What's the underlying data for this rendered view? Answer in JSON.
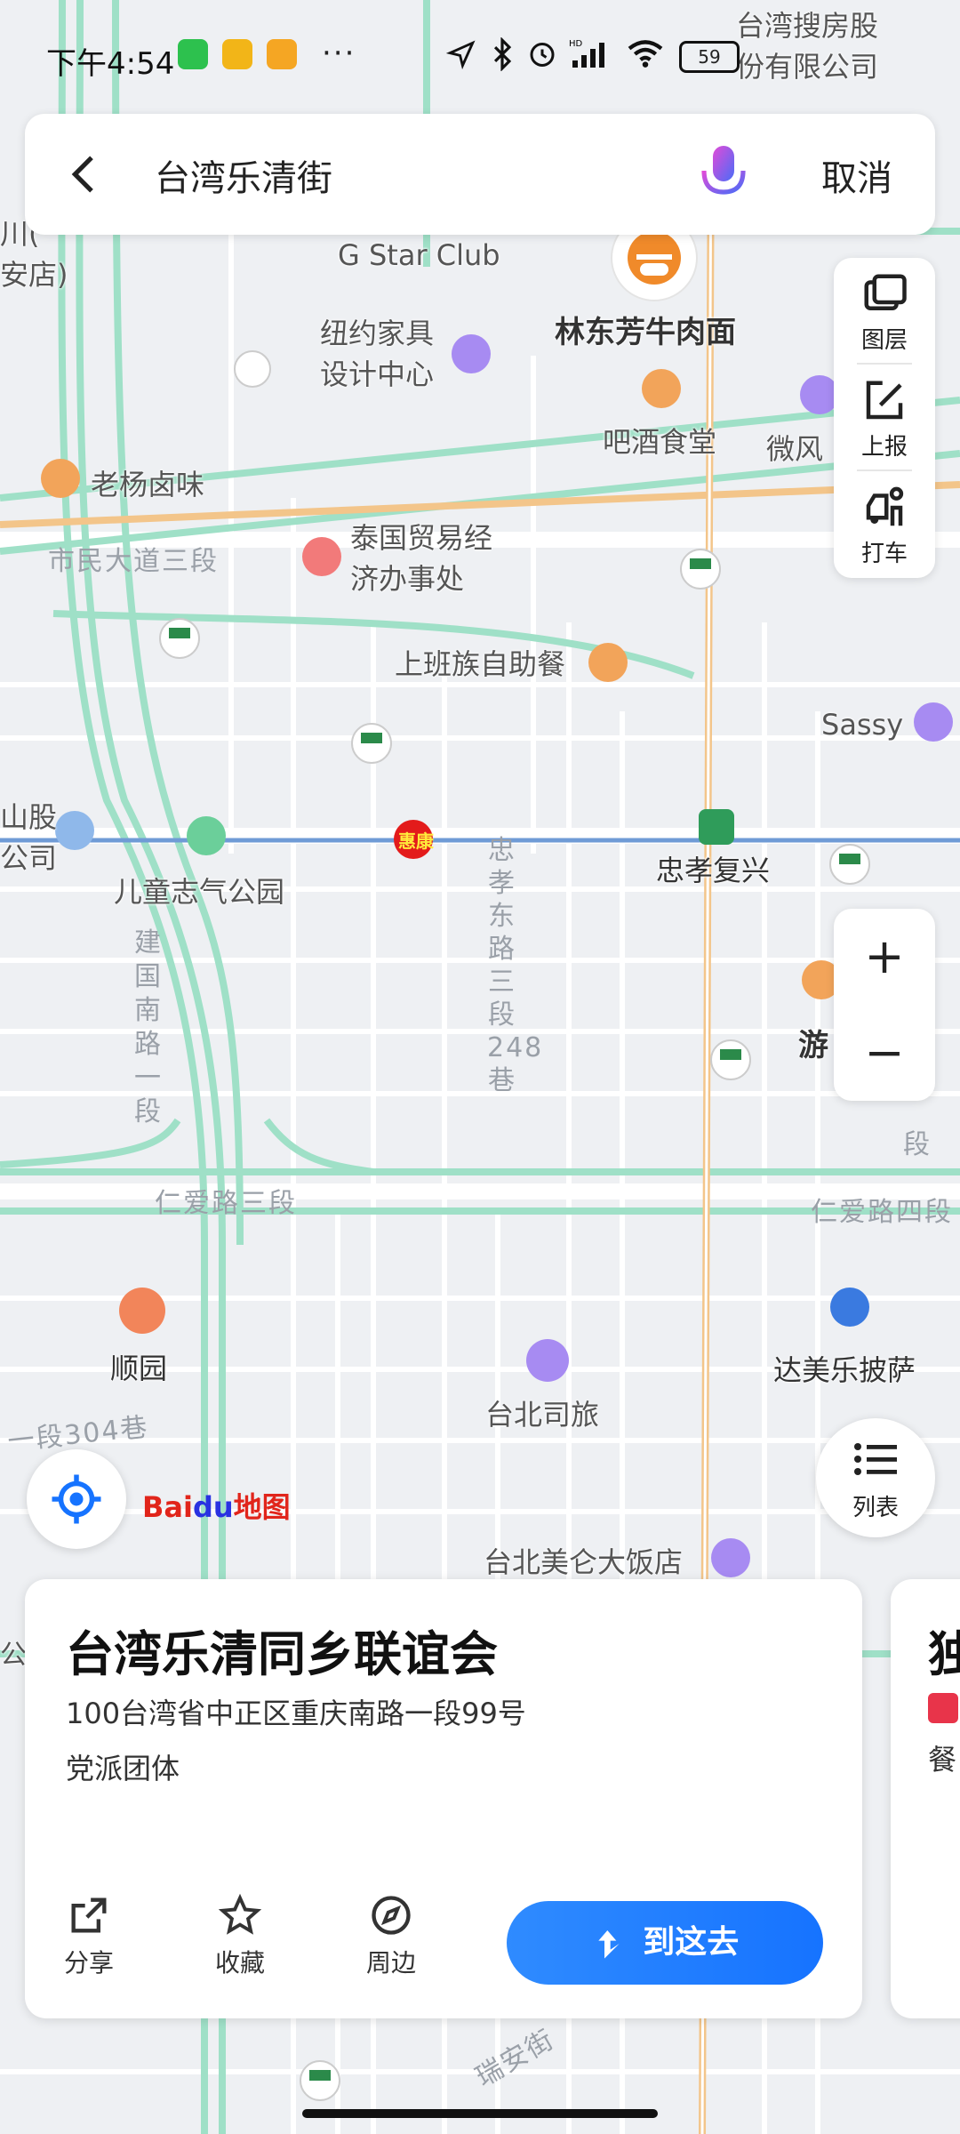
{
  "status_bar": {
    "time": "下午4:54",
    "more": "···",
    "battery": "59"
  },
  "search": {
    "query": "台湾乐清街",
    "cancel_label": "取消"
  },
  "tools": {
    "layers_label": "图层",
    "report_label": "上报",
    "taxi_label": "打车"
  },
  "zoom": {
    "in_label": "+",
    "out_label": "−"
  },
  "list_label": "列表",
  "map_labels": {
    "top_right_company": "台湾搜房股\n份有限公司",
    "left_store": "川(\n安店)",
    "g_star": "G Star Club",
    "beef_noodle": "林东芳牛肉面",
    "ny_design": "纽约家具\n设计中心",
    "bar": "吧酒食堂",
    "weifeng": "微风",
    "laoyang": "老杨卤味",
    "shimin_road": "市民大道三段",
    "thai_office": "泰国贸易经\n济办事处",
    "buffet": "上班族自助餐",
    "sassy": "Sassy",
    "left_company": "山股\n公司",
    "park": "儿童志气公园",
    "zhongxiao_fuxing": "忠孝复兴",
    "zhongxiao_east": "忠孝东路三段248巷",
    "jianguo_south": "建国南路一段",
    "you": "游",
    "duan": "段",
    "renai_3": "仁爱路三段",
    "renai_4": "仁爱路四段",
    "shunyuan": "顺园",
    "dominos": "达美乐披萨",
    "taipei_sl": "台北司旅",
    "lane_304": "一段304巷",
    "mayor_hotel": "台北美仑大饭店",
    "gong": "公园",
    "ruian": "瑞安街",
    "huikang": "惠康"
  },
  "logo": {
    "bai": "Bai",
    "du": "du",
    "ditu": "地图"
  },
  "card": {
    "title": "台湾乐清同乡联谊会",
    "address": "100台湾省中正区重庆南路一段99号",
    "category": "党派团体",
    "share_label": "分享",
    "favorite_label": "收藏",
    "nearby_label": "周边",
    "go_label": "到这去"
  },
  "card2": {
    "title": "独",
    "sub": "餐"
  },
  "colors": {
    "accent": "#1673ff",
    "road_major": "#ffffff",
    "road_green": "#9fe0c7",
    "road_orange": "#f3c58a",
    "map_bg": "#eef0f3",
    "metro": "#6f9bd6"
  }
}
